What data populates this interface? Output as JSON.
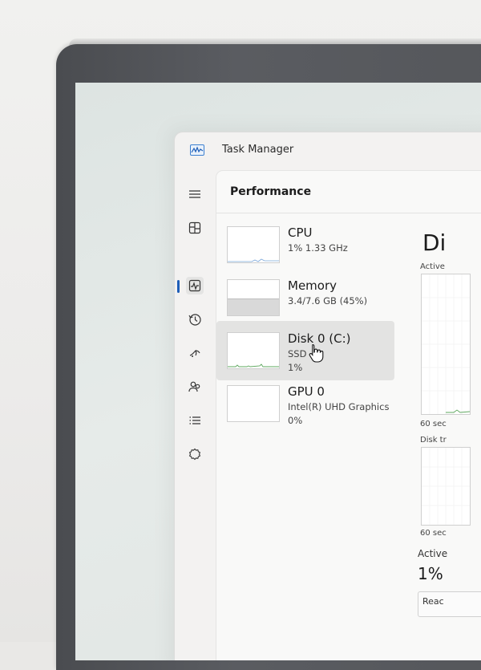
{
  "window": {
    "title": "Task Manager"
  },
  "nav": {
    "items": [
      {
        "icon": "hamburger-menu-icon"
      },
      {
        "icon": "processes-icon"
      },
      {
        "icon": "performance-icon",
        "active": true
      },
      {
        "icon": "app-history-icon"
      },
      {
        "icon": "startup-apps-icon"
      },
      {
        "icon": "users-icon"
      },
      {
        "icon": "details-icon"
      },
      {
        "icon": "services-icon"
      }
    ]
  },
  "performance": {
    "title": "Performance",
    "resources": [
      {
        "name": "CPU",
        "detail": "1%  1.33 GHz",
        "detail2": ""
      },
      {
        "name": "Memory",
        "detail": "3.4/7.6 GB (45%)",
        "detail2": "",
        "fill_fraction": 0.45
      },
      {
        "name": "Disk 0 (C:)",
        "detail": "SSD",
        "detail2": "1%",
        "selected": true
      },
      {
        "name": "GPU 0",
        "detail": "Intel(R) UHD Graphics",
        "detail2": "0%"
      }
    ]
  },
  "detail": {
    "title_partial": "Di",
    "active_label": "Active",
    "seconds_label_1": "60 sec",
    "transfer_label": "Disk tr",
    "seconds_label_2": "60 sec",
    "active_time_label": "Active",
    "active_time_value": "1%",
    "read_label": "Reac"
  },
  "colors": {
    "accent": "#1e5eb8",
    "selected_row": "#e3e3e2",
    "window_bg": "#f3f2f1",
    "bezel": "#55575b"
  }
}
